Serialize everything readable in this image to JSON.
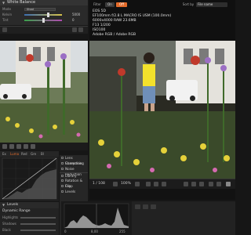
{
  "white_balance": {
    "title": "White Balance",
    "mode_label": "Mode",
    "mode_value": "Shad",
    "kelvin_label": "Kelvin",
    "kelvin_value": "5000",
    "tint_label": "Tint",
    "tint_value": "0"
  },
  "top_bar": {
    "filter_label": "Filter",
    "on_label": "On",
    "off_label": "Off",
    "sort_label": "Sort by",
    "sort_value": "File name"
  },
  "exif": {
    "camera": "EOS 5D",
    "lens": "EF100mm f/2.8 L MACRO IS USM (100.0mm)",
    "size": "6000x4000 RAW 23.6MB",
    "exposure": "F13 1/200",
    "iso": "ISO100",
    "colorspace": "Adobe RGB / Adobe RGB"
  },
  "tool_tabs": [
    "Ex",
    "Luma",
    "Red",
    "Gre",
    "Bl"
  ],
  "tool_menu": [
    "Lens Correction",
    "Sharpening",
    "Noise Reduction",
    "Library",
    "Rotation & Flip",
    "Crop",
    "Levels"
  ],
  "levels_title": "Levels",
  "dynamic_range": {
    "title": "Dynamic Range",
    "rows": [
      "Highlights",
      "Shadows",
      "Black"
    ]
  },
  "viewer": {
    "counter": "1 / 108",
    "zoom": "100%"
  },
  "histogram": {
    "ticks": [
      "0",
      "8,00",
      "255"
    ]
  },
  "colors": {
    "accent": "#e36b2a",
    "panel": "#262626",
    "background": "#161616"
  }
}
